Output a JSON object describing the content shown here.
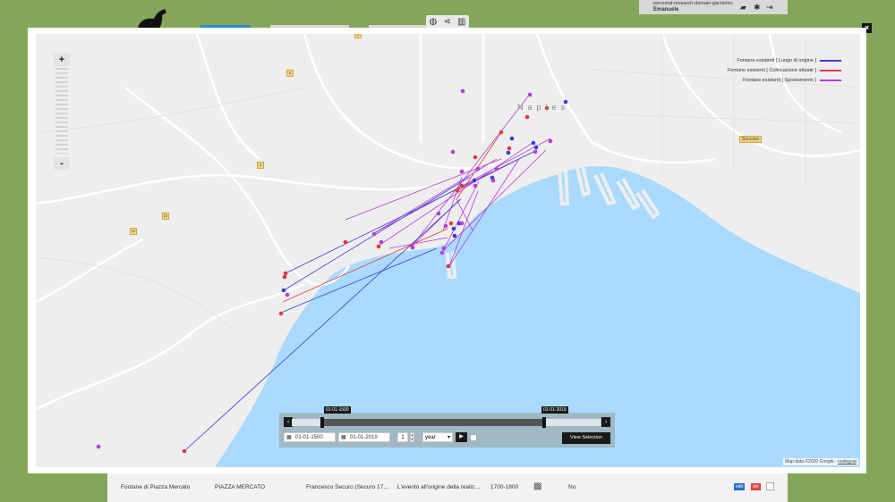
{
  "user": {
    "domain": "personal-research-domain-garziemo",
    "name": "Emanuele"
  },
  "toolbar": {
    "icons": [
      "globe-icon",
      "share-icon",
      "chart-icon"
    ]
  },
  "close_label": "×",
  "map": {
    "city_label": "Naples",
    "place_badge": "Soccavo",
    "route_badges": [
      "6",
      "6",
      "10",
      "10",
      "1"
    ],
    "attribution": "Map data ©2020 Google",
    "attribution_link": "nodegoat",
    "zoom_in": "+",
    "zoom_out": "-"
  },
  "legend": [
    {
      "label": "Fontane esistenti [ Luogo di origine ]",
      "color": "#3b3bdc"
    },
    {
      "label": "Fontane esistenti [ Collocazione attuale ]",
      "color": "#e2383f"
    },
    {
      "label": "Fontane esistenti [ Spostamento ]",
      "color": "#b33fd6"
    }
  ],
  "timeline": {
    "start_tag": "01-01-1500",
    "end_tag": "01-01-2019",
    "start_date": "01-01-1500",
    "end_date": "01-01-2019",
    "step_value": "1",
    "unit": "year",
    "view_selection": "View Selection"
  },
  "table_row": {
    "name": "Fontane di Piazza Mercato",
    "place": "PIAZZA MERCATO",
    "author": "Francesco Securo (Securo 17…",
    "event": "L'evento all'origine della realiz…",
    "period": "1700-1800",
    "flag": "No",
    "edit": "edit",
    "del": "del"
  }
}
